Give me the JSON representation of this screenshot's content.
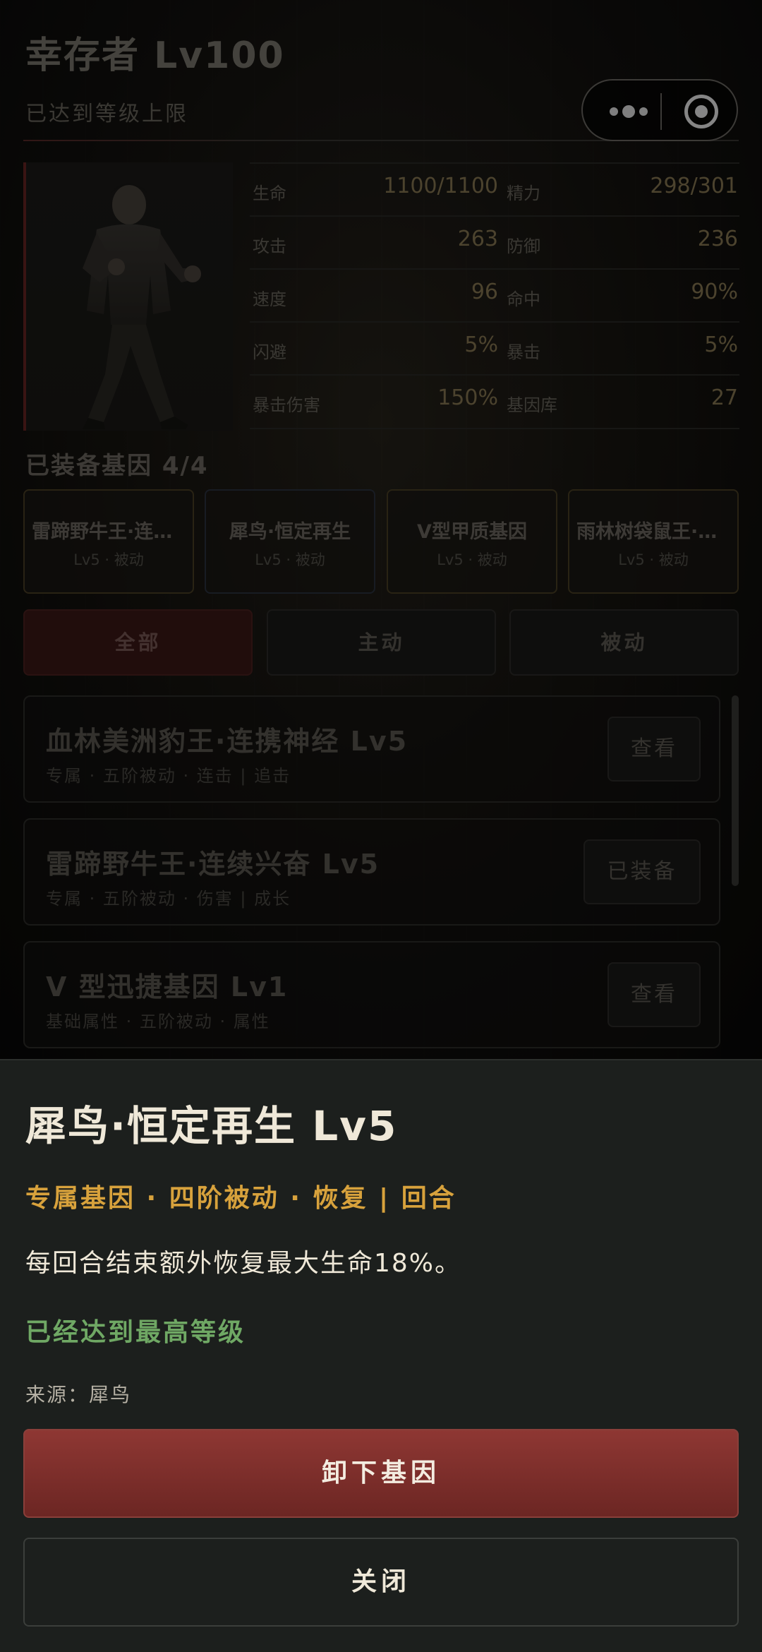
{
  "character": {
    "title": "幸存者 Lv100",
    "subtitle": "已达到等级上限"
  },
  "capsule": {
    "more_icon": "more-dots-icon",
    "close_icon": "target-icon"
  },
  "stats": [
    {
      "label_left": "生命",
      "value_left": "1100/1100",
      "label_right": "精力",
      "value_right": "298/301"
    },
    {
      "label_left": "攻击",
      "value_left": "263",
      "label_right": "防御",
      "value_right": "236"
    },
    {
      "label_left": "速度",
      "value_left": "96",
      "label_right": "命中",
      "value_right": "90%"
    },
    {
      "label_left": "闪避",
      "value_left": "5%",
      "label_right": "暴击",
      "value_right": "5%"
    },
    {
      "label_left": "暴击伤害",
      "value_left": "150%",
      "label_right": "基因库",
      "value_right": "27"
    }
  ],
  "equipped": {
    "title": "已装备基因 4/4",
    "cards": [
      {
        "name": "雷蹄野牛王·连续兴奋",
        "sub": "Lv5 · 被动"
      },
      {
        "name": "犀鸟·恒定再生",
        "sub": "Lv5 · 被动"
      },
      {
        "name": "V型甲质基因",
        "sub": "Lv5 · 被动"
      },
      {
        "name": "雨林树袋鼠王·连击",
        "sub": "Lv5 · 被动"
      }
    ]
  },
  "filter_tabs": [
    {
      "label": "全部",
      "active": true
    },
    {
      "label": "主动",
      "active": false
    },
    {
      "label": "被动",
      "active": false
    }
  ],
  "gene_list": [
    {
      "name": "血林美洲豹王·连携神经 Lv5",
      "sub": "专属 · 五阶被动 · 连击 | 追击",
      "button": "查看"
    },
    {
      "name": "雷蹄野牛王·连续兴奋 Lv5",
      "sub": "专属 · 五阶被动 · 伤害 | 成长",
      "button": "已装备"
    },
    {
      "name": "V 型迅捷基因 Lv1",
      "sub": "基础属性 · 五阶被动 · 属性",
      "button": "查看"
    }
  ],
  "detail": {
    "title": "犀鸟·恒定再生 Lv5",
    "tags": "专属基因 · 四阶被动 · 恢复 | 回合",
    "description": "每回合结束额外恢复最大生命18%。",
    "max_level": "已经达到最高等级",
    "source": "来源：犀鸟",
    "unequip_button": "卸下基因",
    "close_button": "关闭"
  },
  "colors": {
    "accent_red": "#8e3733",
    "tag_gold": "#d8a23c",
    "max_green": "#6fa864",
    "sheet_bg": "#1c1f1d"
  }
}
